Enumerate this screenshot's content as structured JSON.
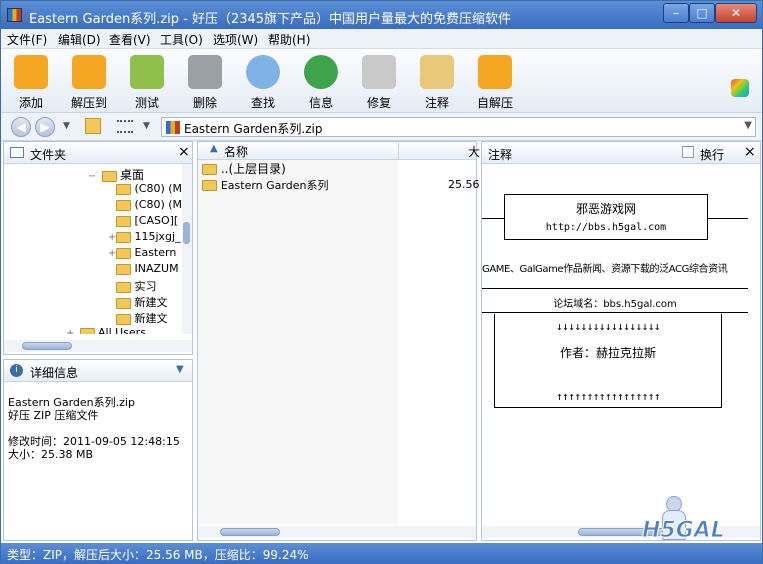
{
  "window": {
    "title": "Eastern Garden系列.zip - 好压（2345旗下产品）中国用户量最大的免费压缩软件",
    "minimize": "–",
    "maximize": "□",
    "close": "✕"
  },
  "menu": [
    "文件(F)",
    "编辑(D)",
    "查看(V)",
    "工具(O)",
    "选项(W)",
    "帮助(H)"
  ],
  "toolbar": [
    {
      "label": "添加",
      "icon": "add-icon",
      "color": "#f5a623"
    },
    {
      "label": "解压到",
      "icon": "extract-icon",
      "color": "#f5a623"
    },
    {
      "label": "测试",
      "icon": "test-icon",
      "color": "#8fc04a"
    },
    {
      "label": "删除",
      "icon": "trash-icon",
      "color": "#9aa0a6"
    },
    {
      "label": "查找",
      "icon": "magnifier-icon",
      "color": "#7fb2e5"
    },
    {
      "label": "信息",
      "icon": "info-icon",
      "color": "#3fa34d"
    },
    {
      "label": "修复",
      "icon": "repair-icon",
      "color": "#c9c9c9"
    },
    {
      "label": "注释",
      "icon": "note-icon",
      "color": "#e8c97a"
    },
    {
      "label": "自解压",
      "icon": "sfx-icon",
      "color": "#f5a623"
    }
  ],
  "address": {
    "path": "Eastern Garden系列.zip"
  },
  "folders_pane": {
    "title": "文件夹",
    "close": "×",
    "items": [
      {
        "label": "桌面",
        "level": 0,
        "expander": "−"
      },
      {
        "label": "(C80) (M",
        "level": 1,
        "expander": ""
      },
      {
        "label": "(C80) (M",
        "level": 1,
        "expander": ""
      },
      {
        "label": "[CASO][",
        "level": 1,
        "expander": ""
      },
      {
        "label": "115jxgj_",
        "level": 1,
        "expander": "+"
      },
      {
        "label": "Eastern",
        "level": 1,
        "expander": "+"
      },
      {
        "label": "INAZUM",
        "level": 1,
        "expander": ""
      },
      {
        "label": "实习",
        "level": 1,
        "expander": ""
      },
      {
        "label": "新建文",
        "level": 1,
        "expander": ""
      },
      {
        "label": "新建文",
        "level": 1,
        "expander": ""
      },
      {
        "label": "All Users",
        "level": -1,
        "expander": "+"
      }
    ]
  },
  "details_pane": {
    "title": "详细信息",
    "filename": "Eastern Garden系列.zip",
    "filetype": "好压 ZIP 压缩文件",
    "modified": "修改时间：2011-09-05 12:48:15",
    "size": "大小：25.38 MB"
  },
  "file_list": {
    "col_name": "名称",
    "col_size": "大",
    "rows": [
      {
        "name": "..(上层目录)",
        "size": ""
      },
      {
        "name": "Eastern Garden系列",
        "size": "25.56"
      }
    ]
  },
  "comment_pane": {
    "title": "注释",
    "wrap_label": "换行",
    "close": "×",
    "site": "邪恶游戏网",
    "url": "http://bbs.h5gal.com",
    "desc": "GAME、GalGame作品新闻、资源下载的泛ACG综合资讯",
    "domain": "论坛域名：bbs.h5gal.com",
    "arrows_down": "↓↓↓↓↓↓↓↓↓↓↓↓↓↓↓↓↓",
    "author": "作者：赫拉克拉斯",
    "arrows_up": "↑↑↑↑↑↑↑↑↑↑↑↑↑↑↑↑↑",
    "watermark": "H5GAL"
  },
  "status": "类型：ZIP，解压后大小：25.56 MB，压缩比：99.24%"
}
